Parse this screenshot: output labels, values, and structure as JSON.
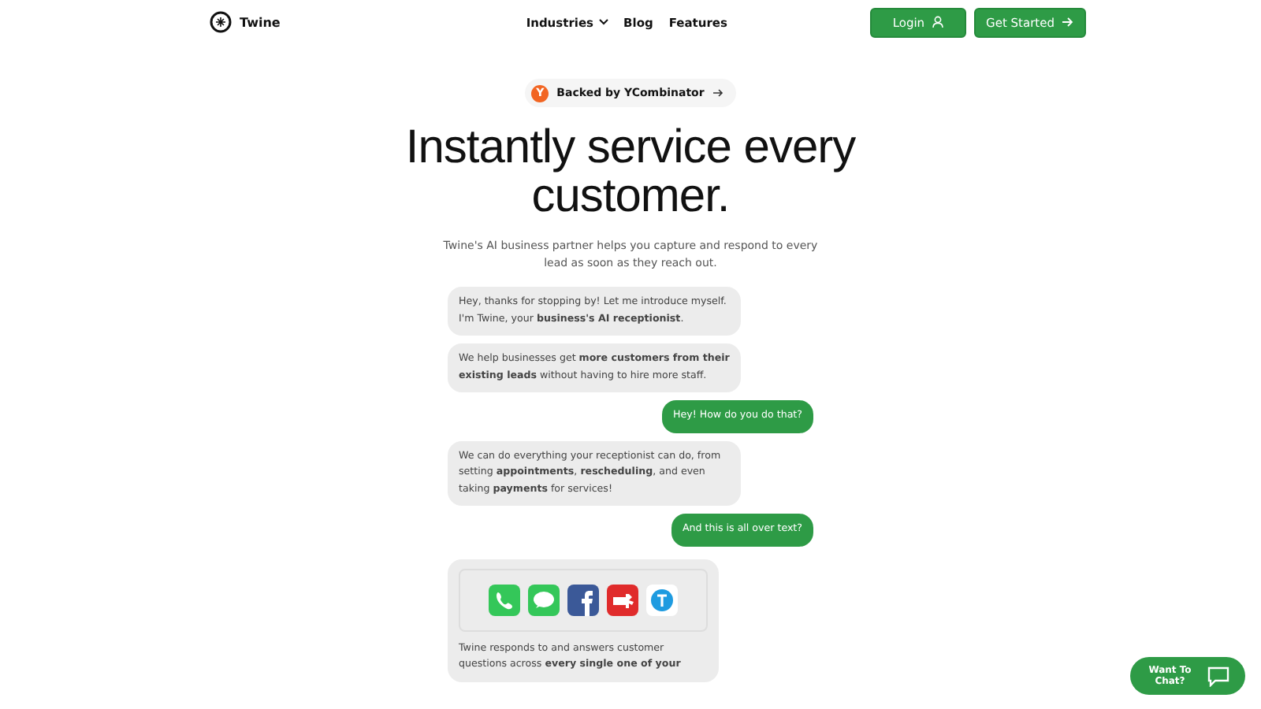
{
  "nav": {
    "brand": "Twine",
    "links": [
      {
        "label": "Industries",
        "dropdown": true
      },
      {
        "label": "Blog",
        "dropdown": false
      },
      {
        "label": "Features",
        "dropdown": false
      }
    ],
    "buttons": [
      {
        "label": "Login",
        "kind": "login"
      },
      {
        "label": "Get Started",
        "kind": "start"
      }
    ]
  },
  "badge": {
    "letter": "Y",
    "label": "Backed by YCombinator"
  },
  "hero": {
    "title": "Instantly service every customer.",
    "subtitle": "Twine's AI business partner helps you capture and respond to every lead as soon as they reach out."
  },
  "messages": [
    {
      "kind": "bot",
      "text": "Hey, thanks for stopping by! Let me introduce myself. I'm Twine, your **business's AI receptionist**."
    },
    {
      "kind": "bot",
      "text": "We help businesses get **more customers from their existing leads** without having to hire more staff."
    },
    {
      "kind": "user",
      "text": "Hey! How do you do that?"
    },
    {
      "kind": "bot",
      "text": "We can do everything your receptionist can do, from setting **appointments**, **rescheduling**, and even taking **payments** for services!"
    },
    {
      "kind": "user",
      "text": "And this is all over text?"
    }
  ],
  "channels_card": {
    "text": "Twine responds to and answers customer questions across **every single one of your**"
  },
  "chat_button": {
    "label": "Want To Chat?"
  }
}
